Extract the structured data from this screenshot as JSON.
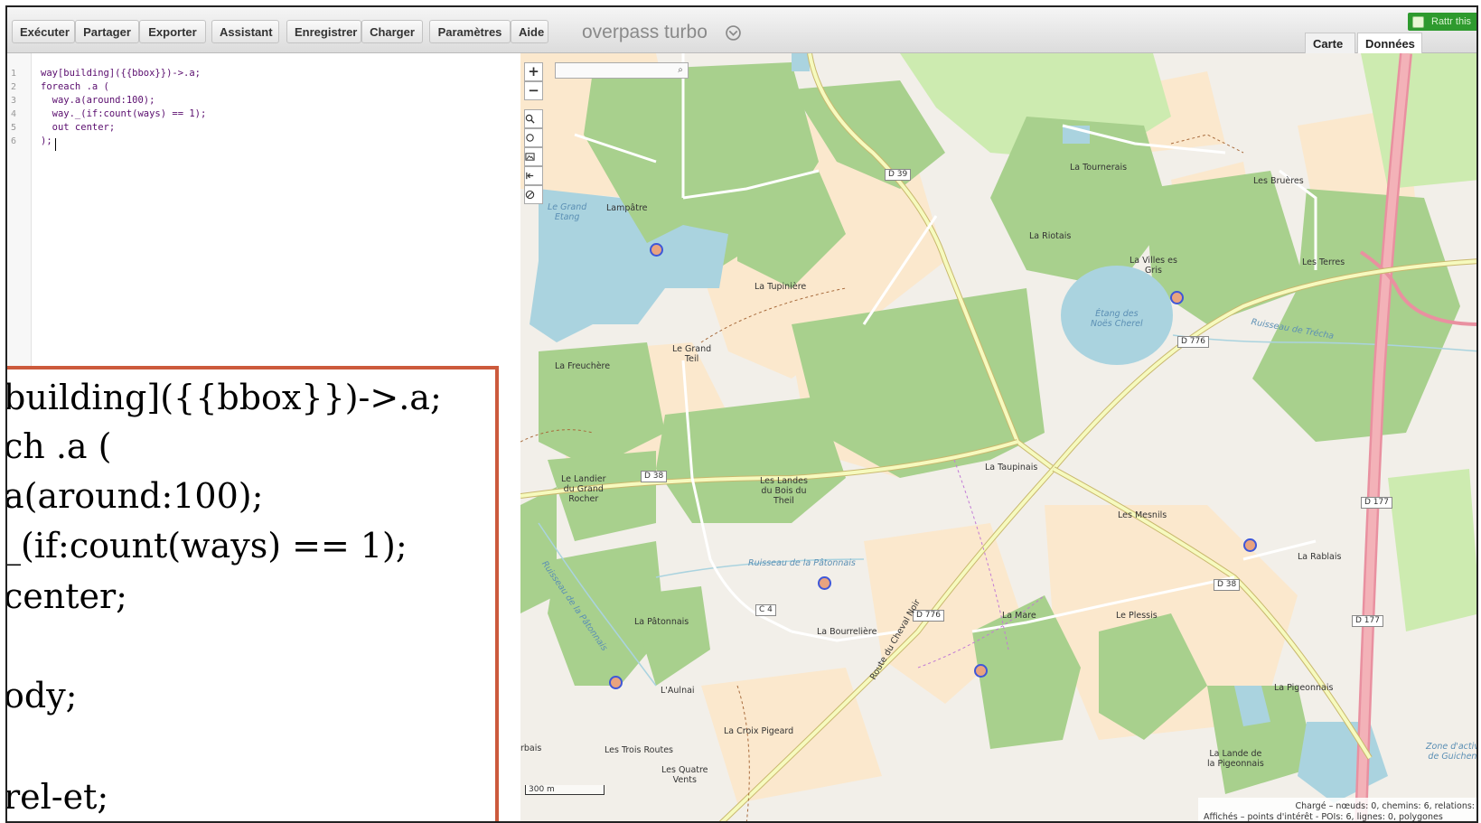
{
  "toolbar": {
    "buttons": [
      "Exécuter",
      "Partager",
      "Exporter",
      "Assistant",
      "Enregistrer",
      "Charger",
      "Paramètres",
      "Aide"
    ],
    "app_title": "overpass turbo",
    "attribution_label": "Rattr this"
  },
  "view_tabs": {
    "map": "Carte",
    "data": "Données"
  },
  "editor": {
    "lines": [
      {
        "n": "1",
        "code": "way[building]({{bbox}})->.a;"
      },
      {
        "n": "2",
        "code": "foreach .a ("
      },
      {
        "n": "3",
        "code": "  way.a(around:100);"
      },
      {
        "n": "4",
        "code": "  way._(if:count(ways) == 1);"
      },
      {
        "n": "5",
        "code": "  out center;"
      },
      {
        "n": "6",
        "code": ");"
      }
    ]
  },
  "overlay_code": {
    "lines": [
      "building]({{bbox}})->.a;",
      "ch .a (",
      "a(around:100);",
      "_(if:count(ways) == 1);",
      "center;",
      "",
      "ody;",
      "",
      "rel-et;"
    ]
  },
  "map": {
    "zoom_in": "+",
    "zoom_out": "−",
    "search_placeholder": "",
    "scale": "300 m",
    "status_line1": "Chargé – nœuds: 0, chemins: 6, relations:",
    "status_line2": "Affichés – points d'intérêt - POIs: 6, lignes: 0, polygones",
    "places": [
      "La Tournerais",
      "Les Bruères",
      "Lampâtre",
      "La Riotais",
      "La Villes es\nGris",
      "Les Terres",
      "La Tupinière",
      "Le Grand\nTeil",
      "La Freuchère",
      "La Taupinais",
      "Le Landier\ndu Grand\nRocher",
      "Les Landes\ndu Bois du\nTheil",
      "Les Mesnils",
      "La Rablais",
      "La Pâtonnais",
      "La Bourrelière",
      "La Mare",
      "Le Plessis",
      "L'Aulnai",
      "La Pigeonnais",
      "La Croix Pigeard",
      "Les Trois Routes",
      "Les Quatre\nVents",
      "La Lande de\nla Pigeonnais",
      "rbais"
    ],
    "water_labels": [
      "Le Grand\nEtang",
      "Étang des\nNoës Cherel",
      "Ruisseau de la Pâtonnais",
      "Ruisseau de la Pâtonnais",
      "Ruisseau de Trécha",
      "Zone d'activ\nde Guichen"
    ],
    "road_refs": [
      "D 39",
      "D 38",
      "D 776",
      "D 177",
      "D 38",
      "C 4",
      "D 776",
      "D 177"
    ],
    "road_names": [
      "Route du Cheval Noir"
    ]
  },
  "colors": {
    "forest": "#a8d08d",
    "farmland": "#fbe8cd",
    "water": "#aad3df",
    "major_road": "#f6fabe",
    "motorway": "#e990a0",
    "poi_fill": "#e9a37f",
    "poi_border": "#3f57d8",
    "overlay_border": "#cc5a3c"
  }
}
